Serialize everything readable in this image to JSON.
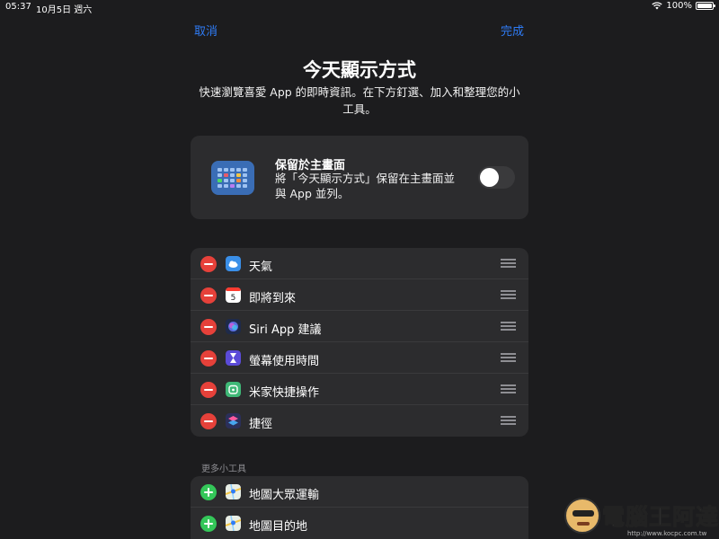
{
  "status_bar": {
    "time": "05:37",
    "date": "10月5日 週六",
    "battery": "100%"
  },
  "nav": {
    "cancel": "取消",
    "done": "完成"
  },
  "header": {
    "title": "今天顯示方式",
    "subtitle": "快速瀏覽喜愛 App 的即時資訊。在下方釘選、加入和整理您的小工具。"
  },
  "keep_card": {
    "title": "保留於主畫面",
    "description": "將「今天顯示方式」保留在主畫面並與 App 並列。",
    "toggle_on": false
  },
  "active_widgets": [
    {
      "label": "天氣",
      "icon": "weather-icon"
    },
    {
      "label": "即將到來",
      "icon": "calendar-icon"
    },
    {
      "label": "Siri App 建議",
      "icon": "siri-icon"
    },
    {
      "label": "螢幕使用時間",
      "icon": "screen-time-icon"
    },
    {
      "label": "米家快捷操作",
      "icon": "mi-home-icon"
    },
    {
      "label": "捷徑",
      "icon": "shortcuts-icon"
    }
  ],
  "more_section": {
    "label": "更多小工具",
    "items": [
      {
        "label": "地圖大眾運輸",
        "icon": "maps-icon"
      },
      {
        "label": "地圖目的地",
        "icon": "maps-icon"
      }
    ]
  },
  "watermark": {
    "brand": "電腦王阿達",
    "url": "http://www.kocpc.com.tw"
  },
  "colors": {
    "accent": "#2f7cf6",
    "remove": "#e6413a",
    "add": "#34c759",
    "background": "#1c1c1e",
    "card": "#2c2c2e"
  }
}
